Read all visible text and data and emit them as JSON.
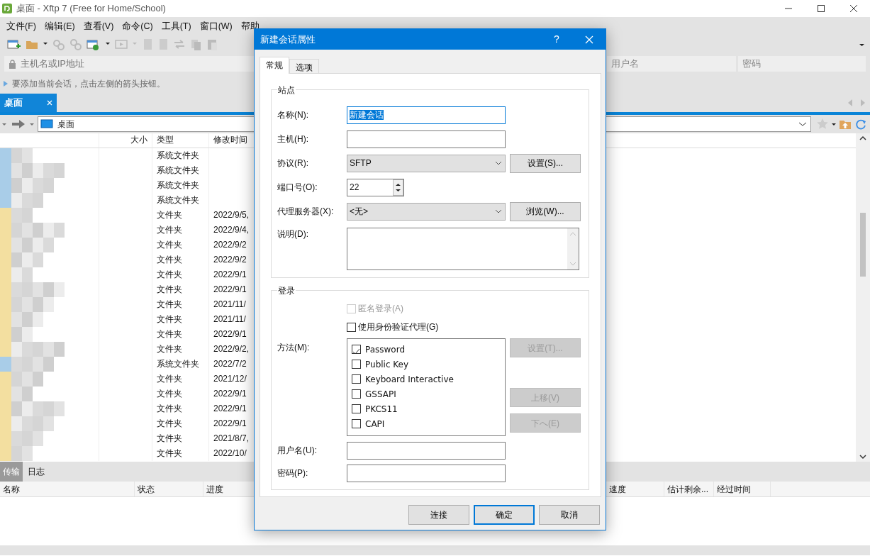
{
  "window": {
    "title": "桌面 - Xftp 7 (Free for Home/School)"
  },
  "menu": [
    "文件(F)",
    "编辑(E)",
    "查看(V)",
    "命令(C)",
    "工具(T)",
    "窗口(W)",
    "帮助"
  ],
  "address_bar": {
    "placeholder": "主机名或IP地址",
    "columns": [
      "用户名",
      "密码"
    ]
  },
  "hint": "要添加当前会话，点击左侧的箭头按钮。",
  "local_tabs": [
    {
      "label": "桌面",
      "selected": true
    }
  ],
  "path": "桌面",
  "file_list": {
    "columns": [
      "大小",
      "类型",
      "修改时间"
    ],
    "rows": [
      {
        "type": "系统文件夹"
      },
      {
        "type": "系统文件夹"
      },
      {
        "type": "系统文件夹"
      },
      {
        "type": "系统文件夹"
      },
      {
        "type": "文件夹",
        "modified": "2022/9/5,"
      },
      {
        "type": "文件夹",
        "modified": "2022/9/4,"
      },
      {
        "type": "文件夹",
        "modified": "2022/9/2"
      },
      {
        "type": "文件夹",
        "modified": "2022/9/2"
      },
      {
        "type": "文件夹",
        "modified": "2022/9/1"
      },
      {
        "type": "文件夹",
        "modified": "2022/9/1"
      },
      {
        "type": "文件夹",
        "modified": "2021/11/"
      },
      {
        "type": "文件夹",
        "modified": "2021/11/"
      },
      {
        "type": "文件夹",
        "modified": "2022/9/1"
      },
      {
        "type": "文件夹",
        "modified": "2022/9/2,"
      },
      {
        "type": "系统文件夹",
        "modified": "2022/7/2"
      },
      {
        "type": "文件夹",
        "modified": "2021/12/"
      },
      {
        "type": "文件夹",
        "modified": "2022/9/1"
      },
      {
        "type": "文件夹",
        "modified": "2022/9/1"
      },
      {
        "type": "文件夹",
        "modified": "2022/9/1"
      },
      {
        "type": "文件夹",
        "modified": "2021/8/7,"
      },
      {
        "type": "文件夹",
        "modified": "2022/10/"
      }
    ]
  },
  "bottom_tabs": [
    {
      "label": "传输",
      "selected": true
    },
    {
      "label": "日志",
      "selected": false
    }
  ],
  "transfer_columns": [
    "名称",
    "状态",
    "进度",
    "速度",
    "估计剩余...",
    "经过时间"
  ],
  "dialog": {
    "title": "新建会话属性",
    "help": "?",
    "tabs": [
      {
        "label": "常规",
        "selected": true
      },
      {
        "label": "选项",
        "selected": false
      }
    ],
    "site": {
      "legend": "站点",
      "name": {
        "label": "名称(N):",
        "value": "新建会话",
        "text_selected": true
      },
      "host": {
        "label": "主机(H):"
      },
      "protocol": {
        "label": "协议(R):",
        "value": "SFTP",
        "button": "设置(S)..."
      },
      "port": {
        "label": "端口号(O):",
        "value": "22"
      },
      "proxy": {
        "label": "代理服务器(X):",
        "value": "<无>",
        "button": "浏览(W)..."
      },
      "description": {
        "label": "说明(D):"
      }
    },
    "login": {
      "legend": "登录",
      "checks": [
        {
          "label": "匿名登录(A)",
          "checked": false,
          "disabled": true
        },
        {
          "label": "使用身份验证代理(G)",
          "checked": false,
          "disabled": false
        }
      ],
      "method": {
        "label": "方法(M):",
        "options": [
          {
            "label": "Password",
            "checked": true
          },
          {
            "label": "Public Key",
            "checked": false
          },
          {
            "label": "Keyboard Interactive",
            "checked": false
          },
          {
            "label": "GSSAPI",
            "checked": false
          },
          {
            "label": "PKCS11",
            "checked": false
          },
          {
            "label": "CAPI",
            "checked": false
          }
        ]
      },
      "method_buttons": [
        {
          "label": "设置(T)...",
          "disabled": true
        },
        {
          "label": "上移(V)",
          "disabled": true
        },
        {
          "label": "下へ(E)",
          "disabled": true
        }
      ],
      "username": {
        "label": "用户名(U):"
      },
      "password": {
        "label": "密码(P):"
      }
    },
    "buttons": [
      {
        "label": "连接",
        "default": false
      },
      {
        "label": "确定",
        "default": true
      },
      {
        "label": "取消",
        "default": false
      }
    ]
  }
}
